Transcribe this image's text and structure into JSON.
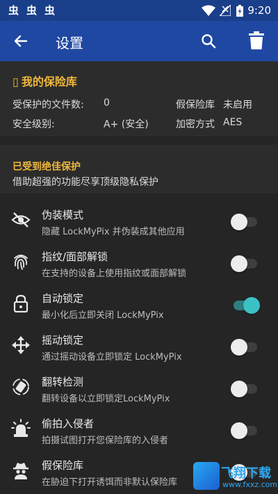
{
  "status_bar": {
    "notification_glyphs": [
      "虫",
      "虫",
      "虫"
    ],
    "time": "9:20",
    "icons": [
      "wifi-icon",
      "signal-icon",
      "battery-icon"
    ]
  },
  "app_bar": {
    "title": "设置",
    "back_icon": "arrow-left-icon",
    "search_icon": "search-icon",
    "delete_icon": "trash-icon",
    "color": "#1f48a3"
  },
  "vault": {
    "icon_glyph": "▯",
    "title": "我的保险库",
    "protected_files_label": "受保护的文件数:",
    "protected_files_value": "0",
    "fake_vault_label": "假保险库",
    "fake_vault_value": "未启用",
    "security_level_label": "安全级别:",
    "security_level_value": "A+ (安全)",
    "encryption_label": "加密方式",
    "encryption_value": "AES"
  },
  "promo": {
    "title": "已受到绝佳保护",
    "subtitle": "借助超强的功能尽享顶级隐私保护"
  },
  "settings": [
    {
      "icon": "eye-off-icon",
      "title": "伪装模式",
      "subtitle": "隐藏 LockMyPix 并伪装成其他应用",
      "enabled": false
    },
    {
      "icon": "fingerprint-icon",
      "title": "指纹/面部解锁",
      "subtitle": "在支持的设备上使用指纹或面部解锁",
      "enabled": false
    },
    {
      "icon": "lock-icon",
      "title": "自动锁定",
      "subtitle": "最小化后立即关闭 LockMyPix",
      "enabled": true
    },
    {
      "icon": "move-arrows-icon",
      "title": "摇动锁定",
      "subtitle": "通过摇动设备立即锁定 LockMyPix",
      "enabled": false
    },
    {
      "icon": "flip-phone-icon",
      "title": "翻转检测",
      "subtitle": "翻转设备以立即锁定LockMyPix",
      "enabled": false
    },
    {
      "icon": "alarm-light-icon",
      "title": "偷拍入侵者",
      "subtitle": "拍摄试图打开您保险库的入侵者",
      "enabled": false
    },
    {
      "icon": "spy-icon",
      "title": "假保险库",
      "subtitle": "在胁迫下打开诱饵而非默认保险库",
      "enabled": false
    }
  ],
  "watermark": {
    "text": "飞翔下载",
    "url": "www.fxxz.com"
  },
  "colors": {
    "accent": "#f0b73a",
    "toggle_on": "#3cc0c4",
    "background": "#252525"
  }
}
